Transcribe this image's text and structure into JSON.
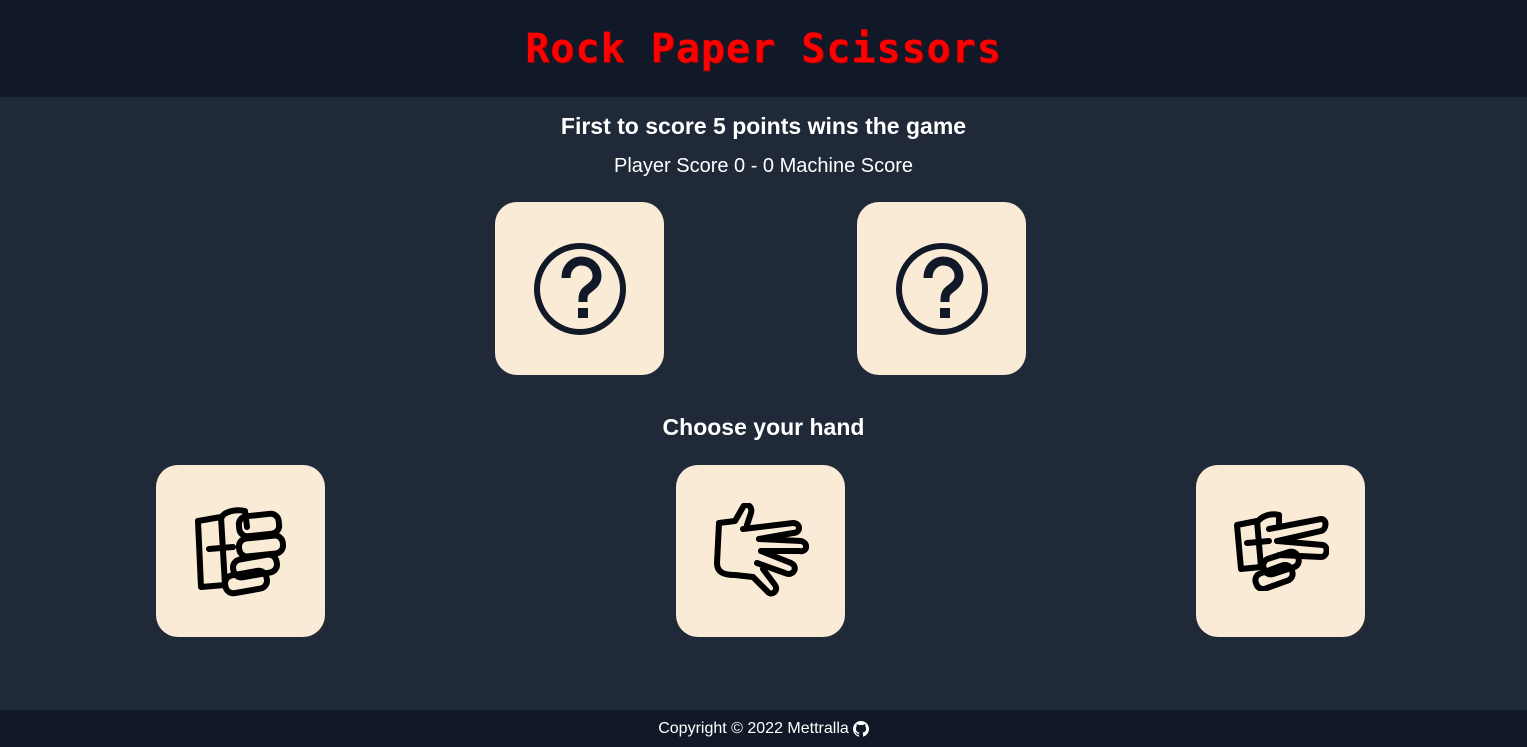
{
  "header": {
    "title": "Rock Paper Scissors"
  },
  "game": {
    "rules": "First to score 5 points wins the game",
    "score_line": "Player Score 0 - 0 Machine Score",
    "player_hand": "question-icon",
    "machine_hand": "question-icon"
  },
  "choices": {
    "heading": "Choose your hand",
    "items": [
      {
        "name": "rock",
        "icon": "fist-icon"
      },
      {
        "name": "paper",
        "icon": "open-hand-icon"
      },
      {
        "name": "scissors",
        "icon": "scissors-hand-icon"
      }
    ]
  },
  "footer": {
    "copyright": "Copyright © 2022 Mettralla",
    "link_icon": "github-icon"
  },
  "colors": {
    "background": "#1f2937",
    "bar": "#111827",
    "title": "#ff0000",
    "card": "#faebd7",
    "icon": "#111827"
  }
}
